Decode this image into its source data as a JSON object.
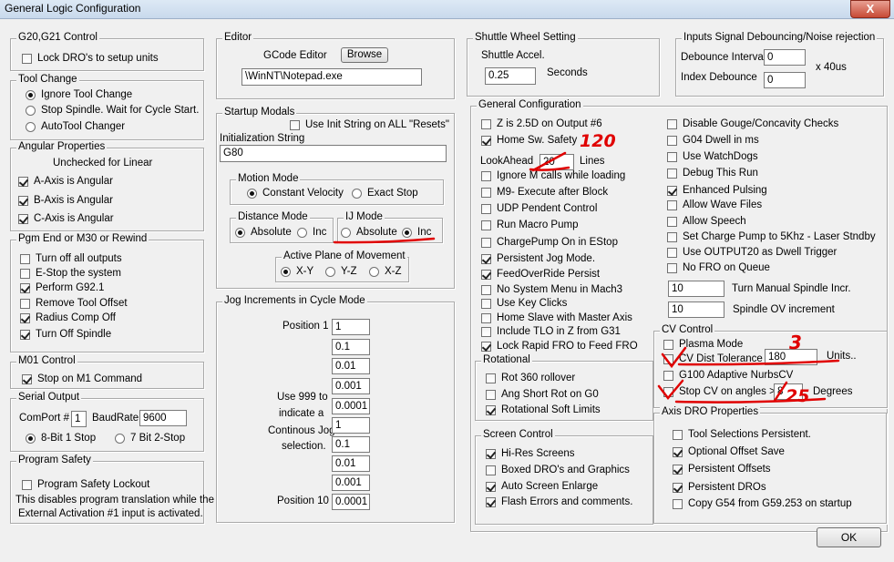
{
  "window": {
    "title": "General Logic Configuration",
    "close": "X"
  },
  "g20": {
    "caption": "G20,G21 Control",
    "lock": "Lock DRO's to setup units"
  },
  "toolchange": {
    "caption": "Tool Change",
    "ignore": "Ignore Tool Change",
    "stop": "Stop Spindle. Wait for Cycle Start.",
    "auto": "AutoTool Changer"
  },
  "angular": {
    "caption": "Angular Properties",
    "note": "Unchecked for Linear",
    "a": "A-Axis is Angular",
    "b": "B-Axis is Angular",
    "c": "C-Axis is Angular"
  },
  "pgmend": {
    "caption": "Pgm End or M30 or Rewind",
    "items": [
      "Turn off all outputs",
      "E-Stop the system",
      "Perform G92.1",
      "Remove Tool Offset",
      "Radius Comp Off",
      "Turn Off Spindle"
    ]
  },
  "m01": {
    "caption": "M01 Control",
    "stop": "Stop on M1 Command"
  },
  "serial": {
    "caption": "Serial Output",
    "comport_label": "ComPort #",
    "comport": "1",
    "baud_label": "BaudRate",
    "baud": "9600",
    "bit8": "8-Bit 1 Stop",
    "bit7": "7 Bit 2-Stop"
  },
  "safety": {
    "caption": "Program Safety",
    "lockout": "Program Safety Lockout",
    "note1": "This disables program translation while the",
    "note2": "External Activation #1 input is activated."
  },
  "editor": {
    "caption": "Editor",
    "label": "GCode Editor",
    "browse": "Browse",
    "path": "\\WinNT\\Notepad.exe"
  },
  "startup": {
    "caption": "Startup Modals",
    "use_init": "Use Init String on ALL  \"Resets\"",
    "init_label": "Initialization String",
    "init_value": "G80",
    "motion": {
      "caption": "Motion Mode",
      "cv": "Constant Velocity",
      "exact": "Exact Stop"
    },
    "distance": {
      "caption": "Distance Mode",
      "abs": "Absolute",
      "inc": "Inc"
    },
    "ij": {
      "caption": "IJ Mode",
      "abs": "Absolute",
      "inc": "Inc"
    },
    "plane": {
      "caption": "Active Plane of Movement",
      "xy": "X-Y",
      "yz": "Y-Z",
      "xz": "X-Z"
    }
  },
  "jog": {
    "caption": "Jog Increments in Cycle Mode",
    "pos1": "Position 1",
    "pos10": "Position 10",
    "note": [
      "Use 999 to",
      "indicate a",
      "Continous Jog",
      "selection."
    ],
    "values": [
      "1",
      "0.1",
      "0.01",
      "0.001",
      "0.0001",
      "1",
      "0.1",
      "0.01",
      "0.001",
      "0.0001"
    ]
  },
  "shuttle": {
    "caption": "Shuttle Wheel Setting",
    "accel": "Shuttle Accel.",
    "value": "0.25",
    "unit": "Seconds"
  },
  "debounce": {
    "caption": "Inputs Signal Debouncing/Noise rejection",
    "interval": "Debounce Interval",
    "interval_val": "0",
    "index": "Index Debounce",
    "index_val": "0",
    "unit": "x 40us"
  },
  "general": {
    "caption": "General Configuration",
    "left": [
      "Z is 2.5D on Output #6",
      "Home Sw. Safety"
    ],
    "lookahead": "LookAhead",
    "lookahead_val": "20",
    "lines": "Lines",
    "left2": [
      "Ignore M calls while loading",
      "M9- Execute after Block",
      "UDP Pendent Control",
      "Run Macro Pump",
      "ChargePump On in EStop",
      "Persistent Jog Mode.",
      "FeedOverRide Persist",
      "No System Menu in Mach3",
      "Use Key Clicks",
      "Home Slave with Master Axis",
      "Include TLO in Z from G31",
      "Lock Rapid FRO to Feed FRO"
    ],
    "right": [
      "Disable Gouge/Concavity Checks",
      "G04 Dwell in ms",
      "Use WatchDogs",
      "Debug This Run",
      "Enhanced Pulsing",
      "Allow Wave Files",
      "Allow Speech",
      "Set Charge Pump to 5Khz  - Laser Stndby",
      "Use OUTPUT20 as Dwell Trigger",
      "No FRO on Queue"
    ],
    "spindle_incr": "10",
    "spindle_incr_label": "Turn Manual Spindle Incr.",
    "spindle_ov": "10",
    "spindle_ov_label": "Spindle OV increment"
  },
  "rotational": {
    "caption": "Rotational",
    "items": [
      "Rot 360 rollover",
      "Ang Short Rot on G0",
      "Rotational Soft Limits"
    ]
  },
  "screen": {
    "caption": "Screen Control",
    "items": [
      "Hi-Res Screens",
      "Boxed DRO's and Graphics",
      "Auto Screen Enlarge",
      "Flash Errors and comments."
    ]
  },
  "cv": {
    "caption": "CV Control",
    "plasma": "Plasma Mode",
    "tol": "CV Dist Tolerance",
    "tol_val": "180",
    "units": "Units..",
    "g100": "G100 Adaptive NurbsCV",
    "stopcv": "Stop CV on angles >",
    "angle_val": "8",
    "degrees": "Degrees"
  },
  "axisdro": {
    "caption": "Axis DRO Properties",
    "items": [
      "Tool Selections Persistent.",
      "Optional Offset Save",
      "Persistent Offsets",
      "Persistent DROs",
      "Copy G54 from G59.253 on startup"
    ]
  },
  "ok": "OK",
  "annotations": {
    "lookahead": "120",
    "tol": "3",
    "angle": "25"
  },
  "colors": {
    "annotation": "#e00000",
    "window_bg": "#f0f0f0"
  }
}
